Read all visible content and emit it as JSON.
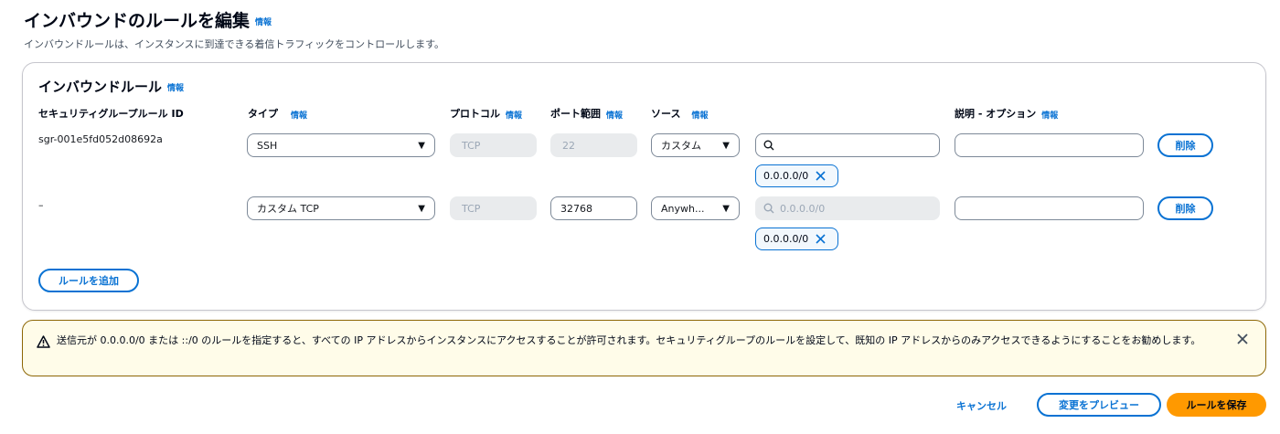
{
  "page": {
    "title": "インバウンドのルールを編集",
    "info": "情報",
    "description": "インバウンドルールは、インスタンスに到達できる着信トラフィックをコントロールします。"
  },
  "panel": {
    "title": "インバウンドルール",
    "info": "情報",
    "columns": {
      "rule_id": "セキュリティグループルール ID",
      "type": "タイプ",
      "protocol": "プロトコル",
      "port_range": "ポート範囲",
      "source": "ソース",
      "description": "説明 - オプション",
      "info": "情報"
    },
    "rows": [
      {
        "rule_id": "sgr-001e5fd052d08692a",
        "type": "SSH",
        "protocol": "TCP",
        "port": "22",
        "source_type": "カスタム",
        "search_value": "",
        "search_placeholder": "",
        "token": "0.0.0.0/0",
        "description": "",
        "delete_label": "削除"
      },
      {
        "rule_id": "–",
        "type": "カスタム TCP",
        "protocol": "TCP",
        "port": "32768",
        "source_type": "Anywh...",
        "search_value": "",
        "search_placeholder": "0.0.0.0/0",
        "token": "0.0.0.0/0",
        "description": "",
        "delete_label": "削除"
      }
    ],
    "add_rule_label": "ルールを追加"
  },
  "warning": {
    "text": "送信元が 0.0.0.0/0 または ::/0 のルールを指定すると、すべての IP アドレスからインスタンスにアクセスすることが許可されます。セキュリティグループのルールを設定して、既知の IP アドレスからのみアクセスできるようにすることをお勧めします。",
    "color": "#8d6605"
  },
  "footer": {
    "cancel_label": "キャンセル",
    "preview_label": "変更をプレビュー",
    "save_label": "ルールを保存"
  },
  "colors": {
    "accent": "#0972d3",
    "primary_button": "#ff9900",
    "warning_background": "#fffce9"
  },
  "icons": {
    "dropdown": "caret-down-icon",
    "search": "search-icon",
    "remove_token": "close-icon",
    "warning": "warning-icon",
    "dismiss": "close-icon"
  }
}
